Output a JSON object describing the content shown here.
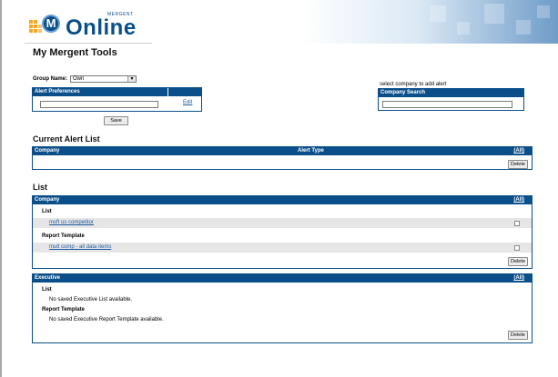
{
  "header": {
    "brand": "Online",
    "brand_prefix": "MERGENT",
    "logo_letter": "M"
  },
  "page": {
    "title": "My Mergent Tools"
  },
  "group": {
    "label": "Group Name:",
    "selected": "Own"
  },
  "alert_preferences": {
    "title": "Alert Preferences",
    "edit_label": "Edit",
    "save_label": "Save",
    "value": ""
  },
  "company_search": {
    "hint": "select company to add alert",
    "title": "Company Search",
    "value": ""
  },
  "current_alert_list": {
    "title": "Current Alert List",
    "col_company": "Company",
    "col_alert_type": "Alert Type",
    "all_label": "(All)",
    "delete_label": "Delete"
  },
  "list_section": {
    "title": "List",
    "company_panel": {
      "title": "Company",
      "all_label": "(All)",
      "list_heading": "List",
      "list_items": [
        "msft us competitor"
      ],
      "report_heading": "Report Template",
      "report_items": [
        "mult comp - all data items"
      ],
      "delete_label": "Delete"
    },
    "executive_panel": {
      "title": "Executive",
      "all_label": "(All)",
      "list_heading": "List",
      "list_empty": "No saved Executive List available.",
      "report_heading": "Report Template",
      "report_empty": "No saved Executive Report Template available.",
      "delete_label": "Delete"
    }
  },
  "colors": {
    "panel_header": "#0b4f8a",
    "link": "#1a5aa0",
    "row_shade": "#e6e6e6"
  }
}
